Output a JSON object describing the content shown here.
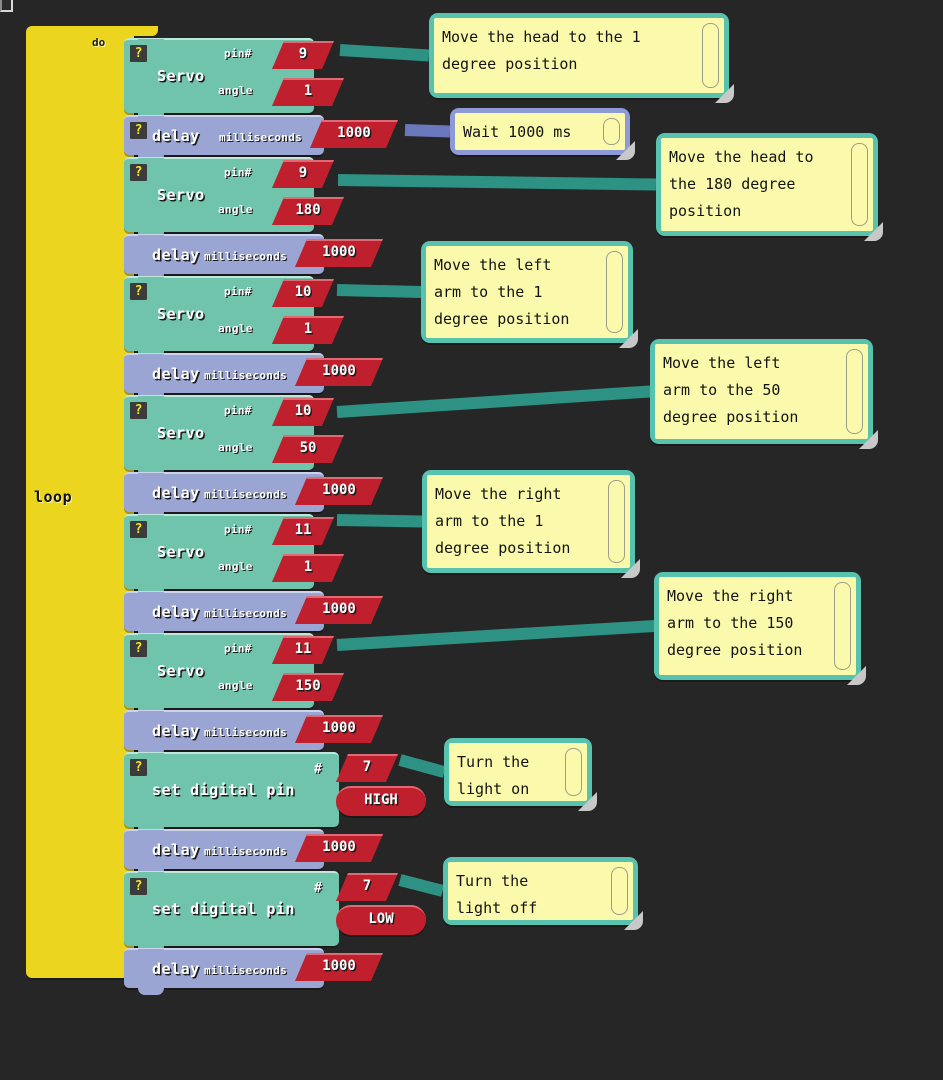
{
  "background_color": "#262626",
  "colors": {
    "loop_block": "#ecd51f",
    "servo_block": "#6fc4ab",
    "delay_block": "#9aa5d4",
    "value_field": "#c01f2e",
    "comment_paper": "#fbf9ab",
    "comment_border_teal": "#57c2ad",
    "comment_border_blue": "#8e9ad6"
  },
  "program": {
    "control": {
      "name": "loop",
      "label": "loop",
      "body_label": "do",
      "help_icon": "?"
    },
    "statements": [
      {
        "type": "servo",
        "label": "Servo",
        "has_help": true,
        "help_icon": "?",
        "fields": [
          {
            "name": "pin",
            "label": "pin#",
            "value": "9"
          },
          {
            "name": "angle",
            "label": "angle",
            "value": "1"
          }
        ]
      },
      {
        "type": "delay",
        "label": "delay",
        "has_help": true,
        "help_icon": "?",
        "fields": [
          {
            "name": "milliseconds",
            "label": "milliseconds",
            "value": "1000"
          }
        ]
      },
      {
        "type": "servo",
        "label": "Servo",
        "has_help": true,
        "help_icon": "?",
        "fields": [
          {
            "name": "pin",
            "label": "pin#",
            "value": "9"
          },
          {
            "name": "angle",
            "label": "angle",
            "value": "180"
          }
        ]
      },
      {
        "type": "delay",
        "label": "delay",
        "has_help": false,
        "fields": [
          {
            "name": "milliseconds",
            "label": "milliseconds",
            "value": "1000"
          }
        ]
      },
      {
        "type": "servo",
        "label": "Servo",
        "has_help": true,
        "help_icon": "?",
        "fields": [
          {
            "name": "pin",
            "label": "pin#",
            "value": "10"
          },
          {
            "name": "angle",
            "label": "angle",
            "value": "1"
          }
        ]
      },
      {
        "type": "delay",
        "label": "delay",
        "has_help": false,
        "fields": [
          {
            "name": "milliseconds",
            "label": "milliseconds",
            "value": "1000"
          }
        ]
      },
      {
        "type": "servo",
        "label": "Servo",
        "has_help": true,
        "help_icon": "?",
        "fields": [
          {
            "name": "pin",
            "label": "pin#",
            "value": "10"
          },
          {
            "name": "angle",
            "label": "angle",
            "value": "50"
          }
        ]
      },
      {
        "type": "delay",
        "label": "delay",
        "has_help": false,
        "fields": [
          {
            "name": "milliseconds",
            "label": "milliseconds",
            "value": "1000"
          }
        ]
      },
      {
        "type": "servo",
        "label": "Servo",
        "has_help": true,
        "help_icon": "?",
        "fields": [
          {
            "name": "pin",
            "label": "pin#",
            "value": "11"
          },
          {
            "name": "angle",
            "label": "angle",
            "value": "1"
          }
        ]
      },
      {
        "type": "delay",
        "label": "delay",
        "has_help": false,
        "fields": [
          {
            "name": "milliseconds",
            "label": "milliseconds",
            "value": "1000"
          }
        ]
      },
      {
        "type": "servo",
        "label": "Servo",
        "has_help": true,
        "help_icon": "?",
        "fields": [
          {
            "name": "pin",
            "label": "pin#",
            "value": "11"
          },
          {
            "name": "angle",
            "label": "angle",
            "value": "150"
          }
        ]
      },
      {
        "type": "delay",
        "label": "delay",
        "has_help": false,
        "fields": [
          {
            "name": "milliseconds",
            "label": "milliseconds",
            "value": "1000"
          }
        ]
      },
      {
        "type": "digital_write",
        "label": "set digital pin",
        "has_help": true,
        "help_icon": "?",
        "fields": [
          {
            "name": "pin",
            "label": "#",
            "value": "7"
          },
          {
            "name": "state",
            "label": "",
            "value": "HIGH"
          }
        ]
      },
      {
        "type": "delay",
        "label": "delay",
        "has_help": false,
        "fields": [
          {
            "name": "milliseconds",
            "label": "milliseconds",
            "value": "1000"
          }
        ]
      },
      {
        "type": "digital_write",
        "label": "set digital pin",
        "has_help": true,
        "help_icon": "?",
        "fields": [
          {
            "name": "pin",
            "label": "#",
            "value": "7"
          },
          {
            "name": "state",
            "label": "",
            "value": "LOW"
          }
        ]
      },
      {
        "type": "delay",
        "label": "delay",
        "has_help": false,
        "fields": [
          {
            "name": "milliseconds",
            "label": "milliseconds",
            "value": "1000"
          }
        ]
      }
    ],
    "comments": [
      {
        "name": "comment-head-1",
        "border": "teal",
        "text": "Move the head to the 1\ndegree position"
      },
      {
        "name": "comment-wait-1000",
        "border": "blue",
        "text": "Wait 1000 ms"
      },
      {
        "name": "comment-head-180",
        "border": "teal",
        "text": "Move the head to\nthe 180 degree\nposition"
      },
      {
        "name": "comment-left-arm-1",
        "border": "teal",
        "text": "Move the left\narm to the 1\ndegree position"
      },
      {
        "name": "comment-left-arm-50",
        "border": "teal",
        "text": "Move the left\narm to the 50\ndegree position"
      },
      {
        "name": "comment-right-arm-1",
        "border": "teal",
        "text": "Move the right\narm to the 1\ndegree position"
      },
      {
        "name": "comment-right-arm-150",
        "border": "teal",
        "text": "Move the right\narm to the 150\ndegree position"
      },
      {
        "name": "comment-light-on",
        "border": "teal",
        "text": "Turn the\nlight on"
      },
      {
        "name": "comment-light-off",
        "border": "teal",
        "text": "Turn the\nlight off"
      }
    ]
  }
}
